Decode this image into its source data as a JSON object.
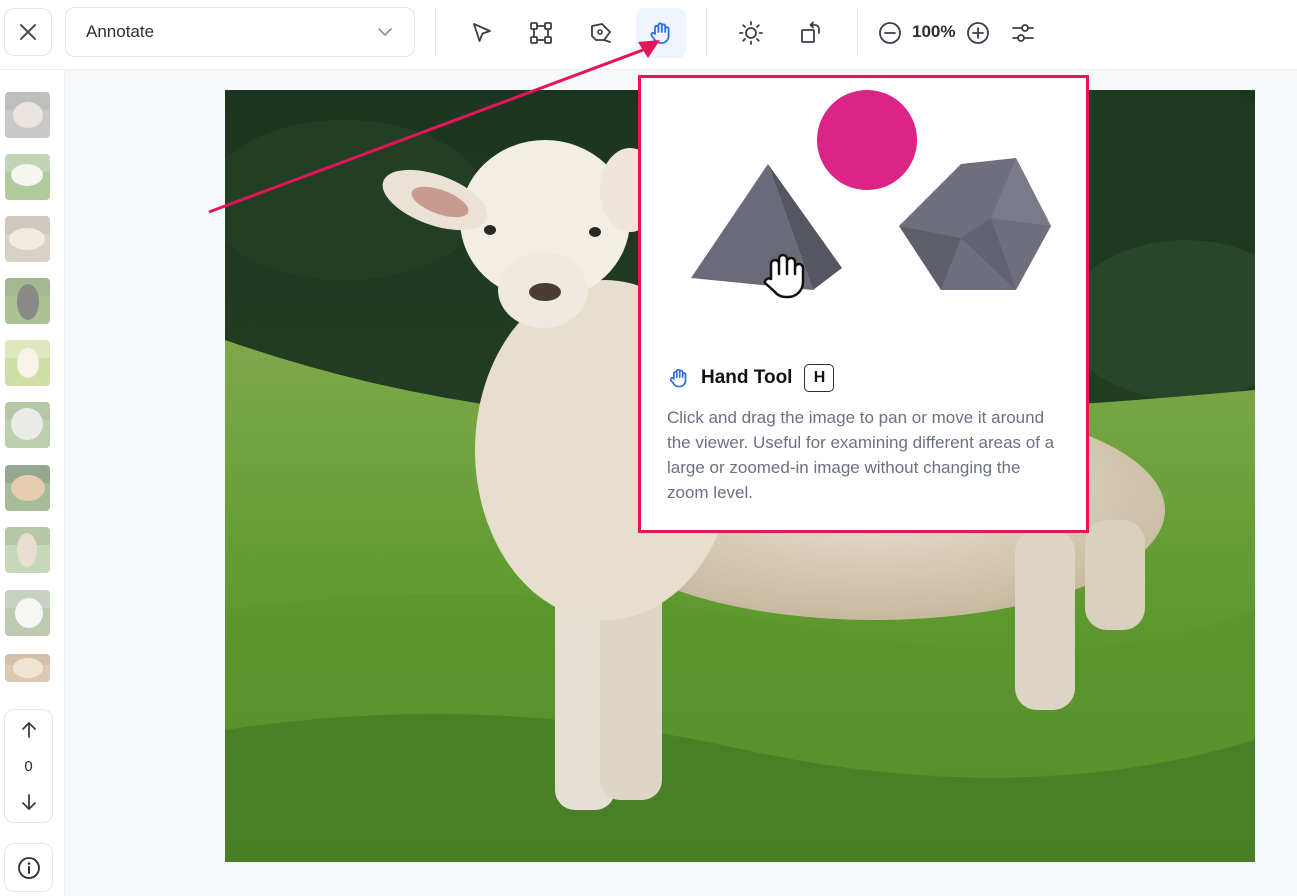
{
  "toolbar": {
    "mode_select": {
      "value": "Annotate"
    },
    "zoom_level": "100%",
    "active_tool": "hand",
    "accent_color": "#2f6fe4"
  },
  "sidebar": {
    "thumbnails": [
      {
        "name": "sheep-face"
      },
      {
        "name": "sheep-white"
      },
      {
        "name": "sheep-pair"
      },
      {
        "name": "sheep-black"
      },
      {
        "name": "lamb-standing"
      },
      {
        "name": "sheep-fluffy"
      },
      {
        "name": "sheep-brown"
      },
      {
        "name": "lamb-front"
      },
      {
        "name": "lamb-white"
      },
      {
        "name": "sheep-partial"
      }
    ],
    "page_number": "0"
  },
  "tooltip": {
    "title": "Hand Tool",
    "shortcut": "H",
    "description": "Click and drag the image to pan or move it around the viewer. Useful for examining different areas of a large or zoomed-in image without changing the zoom level.",
    "highlight_color": "#e6145a"
  }
}
